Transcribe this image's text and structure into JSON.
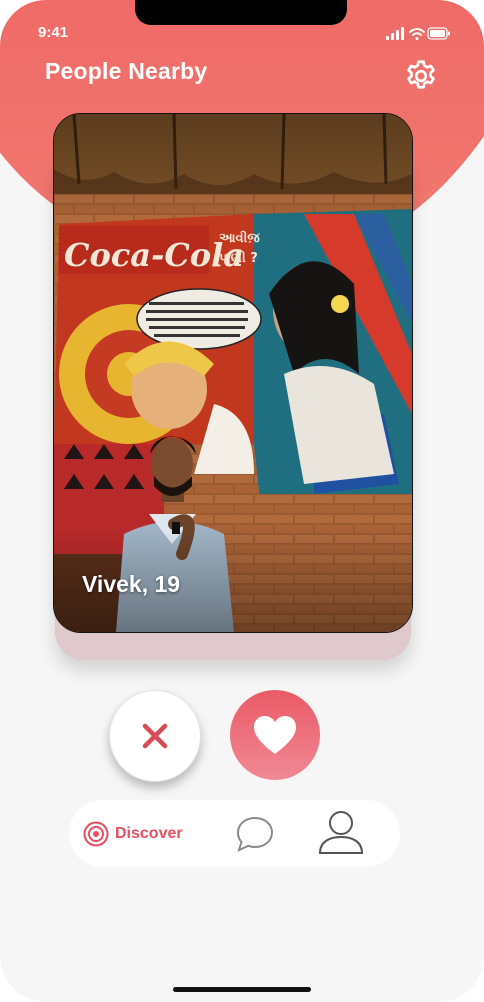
{
  "status_bar": {
    "time": "9:41"
  },
  "header": {
    "title": "People Nearby"
  },
  "profile_card": {
    "name_age": "Vivek, 19"
  },
  "actions": {},
  "tab_bar": {
    "discover_label": "Discover",
    "active_tab": "Discover"
  },
  "icons": {
    "settings": "gear-icon",
    "dislike": "close-icon",
    "like": "heart-icon",
    "discover": "target-icon",
    "chat": "chat-bubble-icon",
    "profile": "user-icon"
  },
  "colors": {
    "accent": "#ea5a66",
    "header_gradient_top": "#ee6363",
    "header_gradient_bottom": "#f07a70",
    "background": "#f6f6f6"
  }
}
